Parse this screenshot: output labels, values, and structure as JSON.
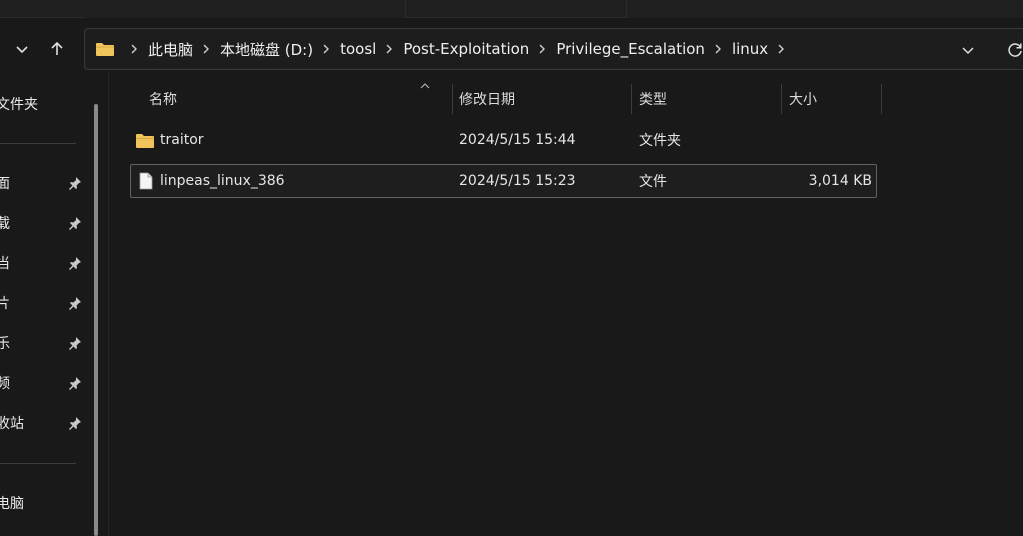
{
  "breadcrumb": {
    "segments": [
      "此电脑",
      "本地磁盘 (D:)",
      "toosl",
      "Post-Exploitation",
      "Privilege_Escalation",
      "linux"
    ]
  },
  "sidebar": {
    "top_item": "文件夹",
    "pinned": [
      "面",
      "载",
      "当",
      "片",
      "乐",
      "频",
      "收站"
    ],
    "bottom_item": "电脑"
  },
  "columns": {
    "name": "名称",
    "modified": "修改日期",
    "type": "类型",
    "size": "大小"
  },
  "files": [
    {
      "name": "traitor",
      "modified": "2024/5/15 15:44",
      "type": "文件夹",
      "size": "",
      "icon": "folder-icon"
    },
    {
      "name": "linpeas_linux_386",
      "modified": "2024/5/15 15:23",
      "type": "文件",
      "size": "3,014 KB",
      "icon": "file-icon"
    }
  ],
  "colors": {
    "background": "#191919",
    "folder": "#f2c55c",
    "text": "#e6e6e6",
    "border": "#3a3a3a"
  }
}
